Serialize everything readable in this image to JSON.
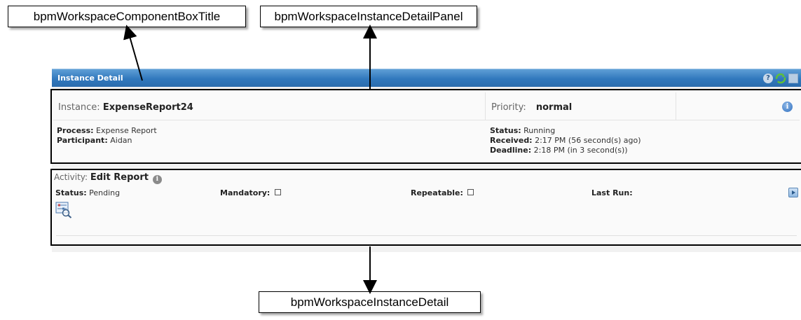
{
  "callouts": {
    "component_box_title": "bpmWorkspaceComponentBoxTitle",
    "instance_detail_panel": "bpmWorkspaceInstanceDetailPanel",
    "instance_detail": "bpmWorkspaceInstanceDetail"
  },
  "titlebar": {
    "title": "Instance Detail",
    "help_icon": "?",
    "icons": [
      "help-icon",
      "refresh-icon",
      "minimize-icon"
    ]
  },
  "instance": {
    "label": "Instance:",
    "value": "ExpenseReport24",
    "priority_label": "Priority:",
    "priority_value": "normal",
    "process_label": "Process:",
    "process_value": "Expense Report",
    "participant_label": "Participant:",
    "participant_value": "Aidan",
    "status_label": "Status:",
    "status_value": "Running",
    "received_label": "Received:",
    "received_value": "2:17 PM (56 second(s) ago)",
    "deadline_label": "Deadline:",
    "deadline_value": "2:18 PM (in 3 second(s))"
  },
  "activity": {
    "label": "Activity:",
    "value": "Edit Report",
    "status_label": "Status:",
    "status_value": "Pending",
    "mandatory_label": "Mandatory:",
    "mandatory_checked": false,
    "repeatable_label": "Repeatable:",
    "repeatable_checked": false,
    "last_run_label": "Last Run:"
  },
  "colors": {
    "titlebar": "#3178bd",
    "panel_bg": "#f1f1f1",
    "border": "#000000"
  }
}
